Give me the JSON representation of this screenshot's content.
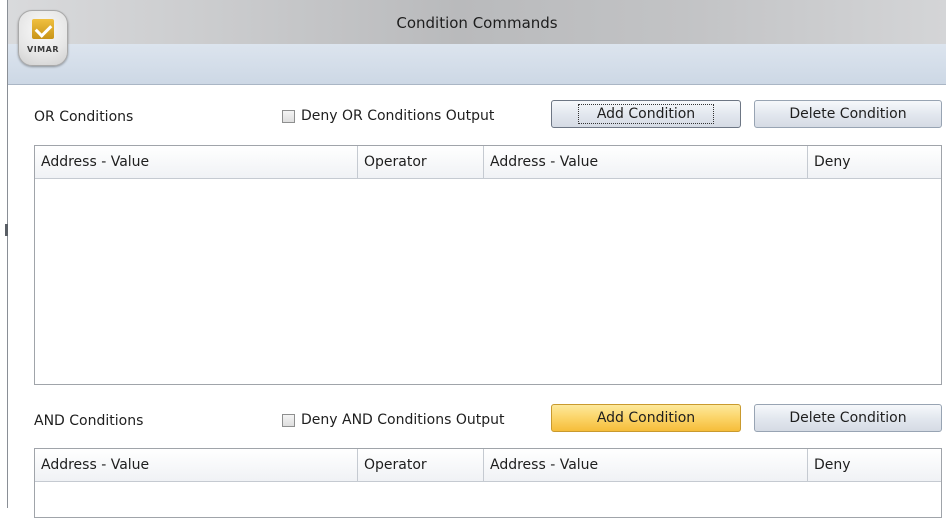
{
  "window": {
    "title": "Condition Commands",
    "logo_text": "VIMAR"
  },
  "or_section": {
    "label": "OR Conditions",
    "deny_checkbox_label": "Deny OR Conditions Output",
    "deny_checked": false,
    "add_button": "Add Condition",
    "delete_button": "Delete Condition",
    "columns": [
      "Address - Value",
      "Operator",
      "Address - Value",
      "Deny"
    ],
    "rows": []
  },
  "and_section": {
    "label": "AND Conditions",
    "deny_checkbox_label": "Deny AND Conditions Output",
    "deny_checked": false,
    "add_button": "Add Condition",
    "delete_button": "Delete Condition",
    "columns": [
      "Address - Value",
      "Operator",
      "Address - Value",
      "Deny"
    ],
    "rows": []
  },
  "colors": {
    "hot_button": "#fbd468",
    "header_band": "#cdd8e5"
  }
}
